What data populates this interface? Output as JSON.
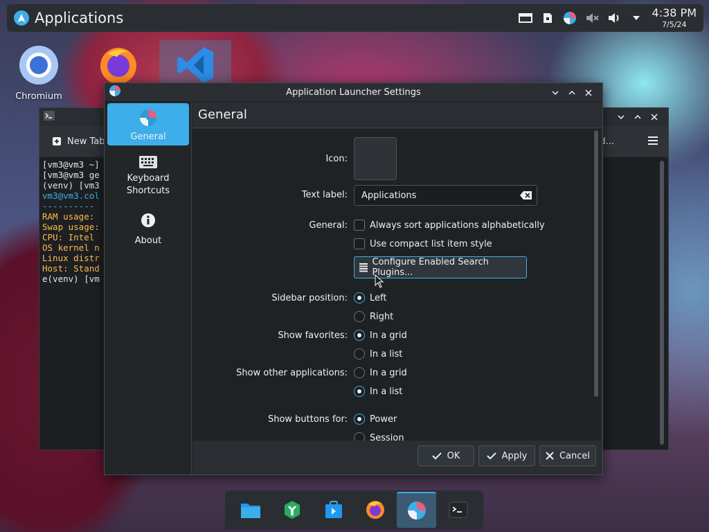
{
  "top_panel": {
    "title": "Applications",
    "clock_time": "4:38 PM",
    "clock_date": "7/5/24",
    "tray_icons": [
      "window-icon",
      "save-icon",
      "launcher-icon",
      "muted-icon",
      "volume-icon",
      "arrow-down-icon"
    ]
  },
  "desktop": {
    "icons": [
      {
        "label": "Chromium",
        "icon": "chromium-icon"
      },
      {
        "label": "",
        "icon": "firefox-icon"
      },
      {
        "label": "",
        "icon": "vscode-icon"
      }
    ]
  },
  "terminal": {
    "new_tab": "New Tab",
    "find": "Find...",
    "lines": [
      {
        "text": "[vm3@vm3 ~]",
        "color": "#e6e9eb"
      },
      {
        "text": "[vm3@vm3 ge",
        "color": "#e6e9eb"
      },
      {
        "text": "(venv) [vm3",
        "color": "#e6e9eb"
      },
      {
        "text": "vm3@vm3.col",
        "color": "#3daee9"
      },
      {
        "text": "----------",
        "color": "#3daee9"
      },
      {
        "text": "RAM usage:",
        "color": "#fdbc4b"
      },
      {
        "text": "Swap usage:",
        "color": "#fdbc4b"
      },
      {
        "text": "CPU: Intel",
        "color": "#fdbc4b"
      },
      {
        "text": "OS kernel n",
        "color": "#fdbc4b"
      },
      {
        "text": "Linux distr",
        "color": "#fdbc4b"
      },
      {
        "text": "Host: Stand",
        "color": "#fdbc4b"
      },
      {
        "text": "e(venv) [vm",
        "color": "#e6e9eb"
      }
    ]
  },
  "dialog": {
    "title": "Application Launcher Settings",
    "sidebar": [
      {
        "label": "General",
        "active": true
      },
      {
        "label": "Keyboard Shortcuts",
        "active": false
      },
      {
        "label": "About",
        "active": false
      }
    ],
    "page_title": "General",
    "icon_label": "Icon:",
    "text_label_label": "Text label:",
    "text_label_value": "Applications",
    "general_label": "General:",
    "checkbox_sort": "Always sort applications alphabetically",
    "checkbox_compact": "Use compact list item style",
    "configure_button": "Configure Enabled Search Plugins...",
    "sidebar_position_label": "Sidebar position:",
    "sidebar_left": "Left",
    "sidebar_right": "Right",
    "favorites_label": "Show favorites:",
    "fav_grid": "In a grid",
    "fav_list": "In a list",
    "other_label": "Show other applications:",
    "other_grid": "In a grid",
    "other_list": "In a list",
    "buttons_label": "Show buttons for:",
    "btn_power": "Power",
    "btn_session": "Session",
    "ok": "OK",
    "apply": "Apply",
    "cancel": "Cancel"
  },
  "taskbar": {
    "items": [
      "file-manager-icon",
      "settings-icon",
      "discover-icon",
      "firefox-icon",
      "launcher-settings-icon",
      "terminal-icon"
    ]
  },
  "colors": {
    "accent": "#3daee9",
    "panel": "#2a2e32"
  }
}
